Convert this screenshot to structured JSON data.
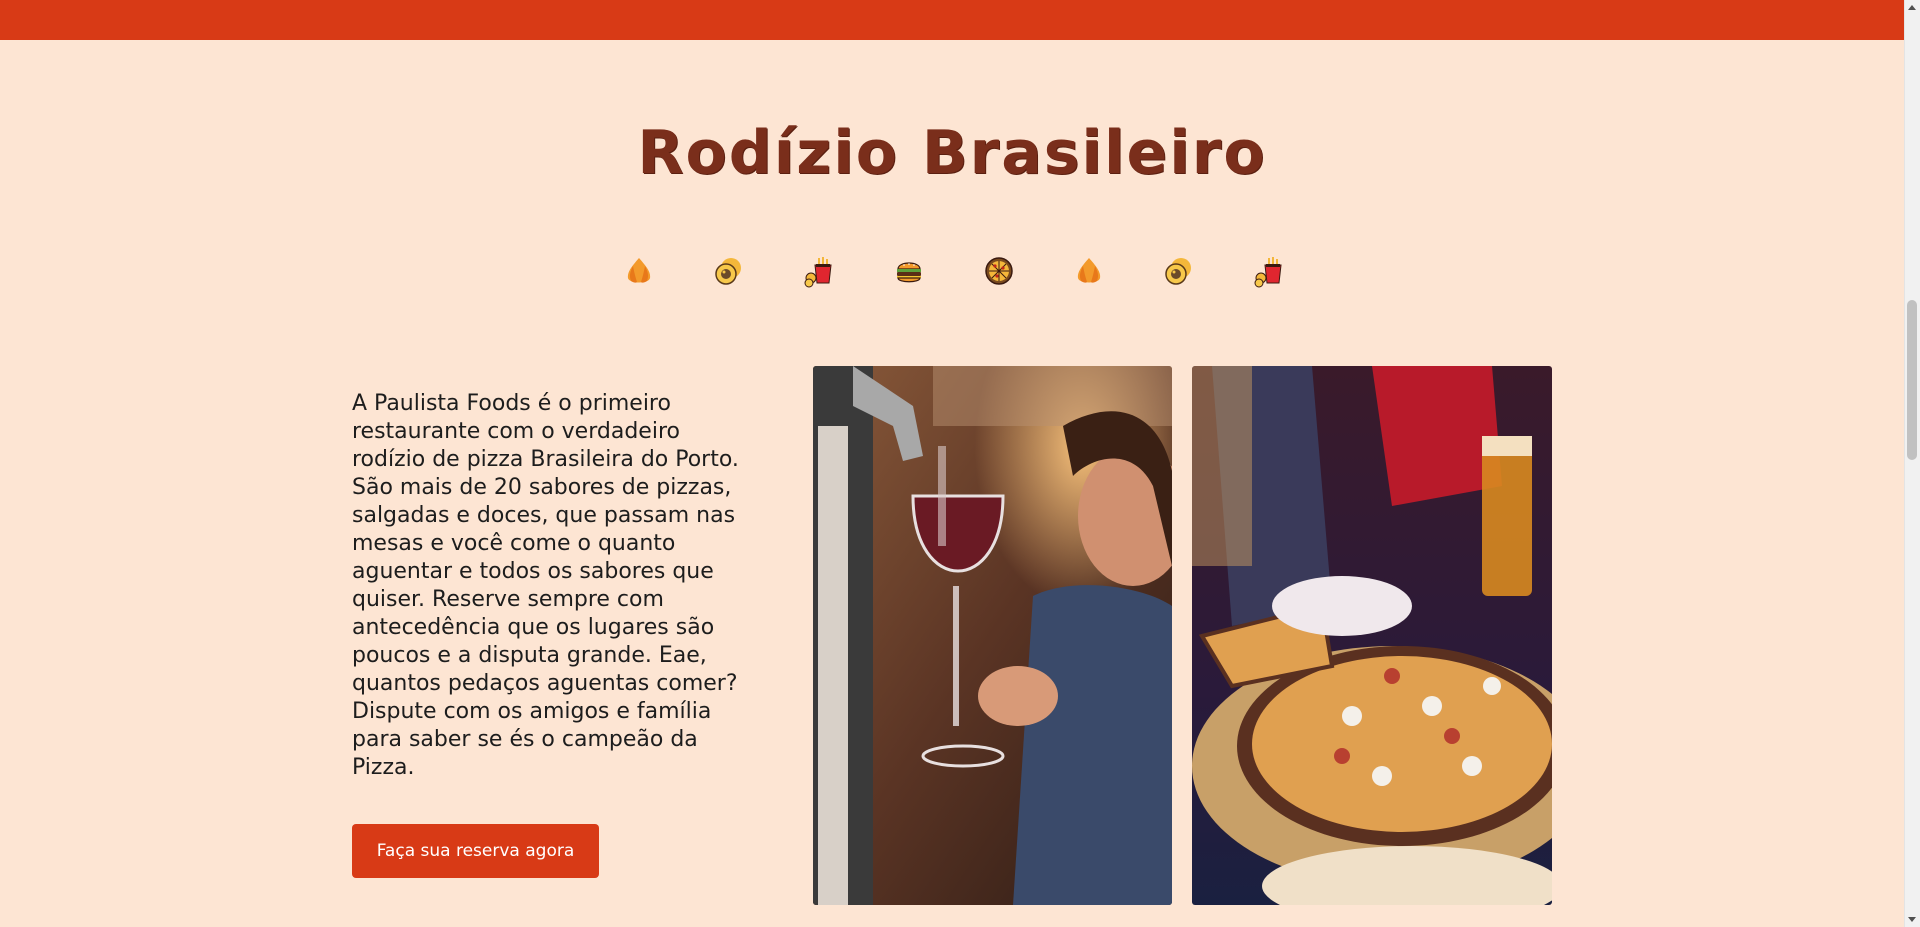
{
  "section": {
    "title": "Rodízio Brasileiro",
    "description": "A Paulista Foods é o primeiro restaurante com o verdadeiro rodízio de pizza Brasileira do Porto. São mais de 20 sabores de pizzas, salgadas e doces, que passam nas mesas e você come o quanto aguentar e todos os sabores que quiser. Reserve sempre com antecedência que os lugares são poucos e a disputa grande. Eae, quantos pedaços aguentas comer? Dispute com os amigos e família para saber se és o campeão da Pizza.",
    "cta_label": "Faça sua reserva agora"
  },
  "food_icons": [
    "coxinha-icon",
    "pastel-icon",
    "fries-bucket-icon",
    "burger-icon",
    "pizza-icon",
    "coxinha-icon",
    "pastel-icon",
    "fries-bucket-icon"
  ],
  "photos": [
    {
      "name": "wine-pour-photo"
    },
    {
      "name": "pizza-table-photo"
    }
  ],
  "colors": {
    "brand_red": "#d83a16",
    "background": "#fde5d3",
    "title_brown": "#7a2e1b"
  }
}
